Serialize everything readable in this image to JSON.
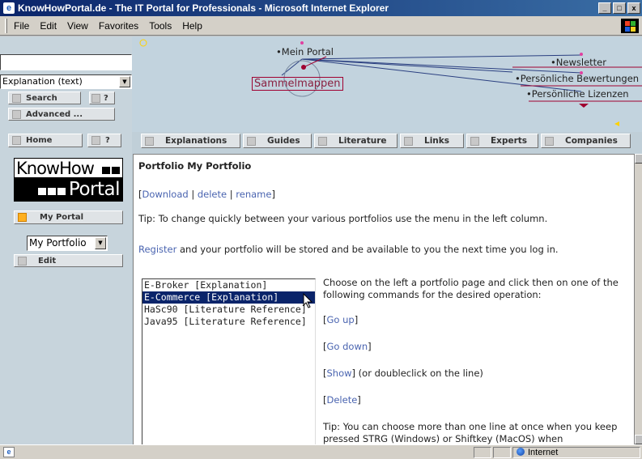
{
  "window": {
    "title": "KnowHowPortal.de - The IT Portal for Professionals - Microsoft Internet Explorer",
    "controls": {
      "minimize": "_",
      "maximize": "□",
      "close": "x"
    }
  },
  "menu": [
    "File",
    "Edit",
    "View",
    "Favorites",
    "Tools",
    "Help"
  ],
  "sidebar": {
    "search_value": "",
    "search_type": "Explanation (text)",
    "search_button": "Search",
    "help_button": "?",
    "advanced_button": "Advanced ...",
    "home_button": "Home",
    "home_help_button": "?",
    "logo_line1": "KnowHow",
    "logo_line2": "Portal",
    "my_portal_button": "My Portal",
    "portfolio_select": "My Portfolio",
    "edit_button": "Edit"
  },
  "header_nav": {
    "mein_portal": "Mein Portal",
    "sammelmappen": "Sammelmappen",
    "newsletter": "Newsletter",
    "bewertungen": "Persönliche Bewertungen",
    "lizenzen": "Persönliche Lizenzen"
  },
  "tabs": [
    "Explanations",
    "Guides",
    "Literature",
    "Links",
    "Experts",
    "Companies"
  ],
  "content": {
    "heading": "Portfolio My Portfolio",
    "open_bracket": "[",
    "download": "Download",
    "sep": " | ",
    "delete": "delete",
    "rename": "rename",
    "close_bracket": "]",
    "tip1": "Tip: To change quickly between your various portfolios use the menu in the left column.",
    "register": "Register",
    "register_rest": " and your portfolio will be stored and be available to you the next time you log in.",
    "list_items": [
      "E-Broker [Explanation]",
      "E-Commerce [Explanation]",
      "HaSc90 [Literature Reference]",
      "Java95 [Literature Reference]"
    ],
    "selected_index": 1,
    "instructions": "Choose on the left a portfolio page and click then on one of the following commands for the desired operation:",
    "go_up": "Go up",
    "go_down": "Go down",
    "show": "Show",
    "show_rest": " (or doubleclick on the line)",
    "delete_cmd": "Delete",
    "tip2": "Tip: You can choose more than one line at once when you keep pressed STRG (Windows) or Shiftkey (MacOS) when"
  },
  "status": {
    "zone": "Internet"
  },
  "colors": {
    "title_bar": "#0a246a",
    "selection": "#0a246a",
    "link": "#4a64b0",
    "logo_bg": "#000000"
  }
}
